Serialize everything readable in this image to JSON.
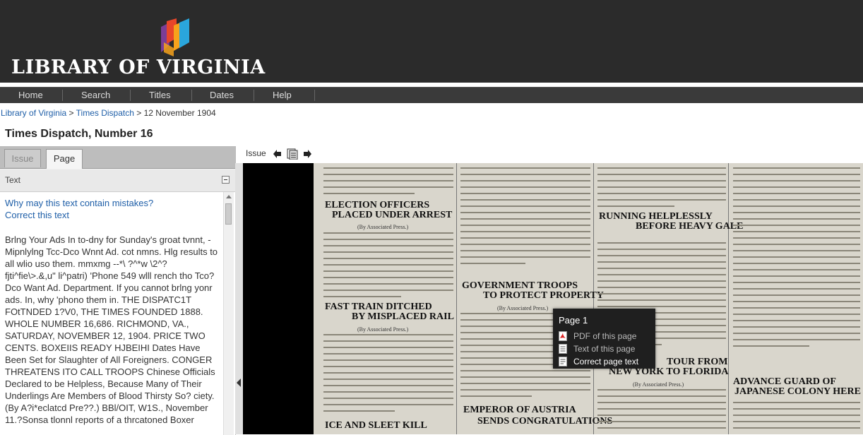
{
  "brand": {
    "logo_text": "LIBRARY OF VIRGINIA",
    "logo_colors": [
      "#e8462a",
      "#f7a21b",
      "#2aa6dc",
      "#7a3d96"
    ]
  },
  "nav": {
    "items": [
      {
        "label": "Home"
      },
      {
        "label": "Search"
      },
      {
        "label": "Titles"
      },
      {
        "label": "Dates"
      },
      {
        "label": "Help"
      }
    ]
  },
  "breadcrumb": {
    "items": [
      "Library of Virginia",
      "Times Dispatch"
    ],
    "separator": ">",
    "current": "12 November 1904"
  },
  "page_title": "Times Dispatch, Number 16",
  "left_panel": {
    "tabs": [
      {
        "label": "Issue",
        "active": false
      },
      {
        "label": "Page",
        "active": true
      }
    ],
    "section_label": "Text",
    "links": {
      "mistakes": "Why may this text contain mistakes?",
      "correct": "Correct this text"
    },
    "ocr_text": "Brlng Your Ads In to-dny for Sunday's groat tvnnt, -Mipnlylng Tcc-Dco Wnnt Ad. cot nmns. Hlg results to all wlio uso them. mmxmg --*\\ ?^*w \\2^? fjti^fie\\>.&,u\" li^patri) 'Phone 549 wlll rench tho Tco?Dco Want Ad. Department. If you cannot brlng yonr ads. In, why 'phono them in. THE DISPATC1T FOtTNDED 1?V0, THE TIMES FOUNDED 1888. WHOLE NUMBER 16,686. RICHMOND, VA., SATURDAY, NOVEMBER 12, 1904. PRICE TWO CENTS. BOXEIIS READY HJBEIHI Dates Have Been Set for Slaughter of All Foreigners. CONGER THREATENS ITO CALL TROOPS Chinese Officials Declared to be Helpless, Because Many of Their Underlings Are Members of Blood Thirsty So? ciety. (By A?i*eclatcd Pre??.) BBl/OIT, W1S., November 11.?Sonsa tlonnl reports of a thrcatoned Boxer"
  },
  "viewer": {
    "label": "Issue",
    "headlines": {
      "c1a": "ELECTION OFFICERS",
      "c1b": "PLACED UNDER ARREST",
      "c1c": "FAST TRAIN DITCHED",
      "c1d": "BY MISPLACED RAIL",
      "c1e": "ICE AND SLEET KILL",
      "c2a": "GOVERNMENT TROOPS",
      "c2b": "TO PROTECT PROPERTY",
      "c2c": "EMPEROR OF AUSTRIA",
      "c2d": "SENDS CONGRATULATIONS",
      "c3a": "RUNNING HELPLESSLY",
      "c3b": "BEFORE HEAVY GALE",
      "c3c": "TOUR FROM",
      "c3d": "NEW YORK TO FLORIDA",
      "c4a": "ADVANCE GUARD OF",
      "c4b": "JAPANESE COLONY HERE"
    },
    "bylines": {
      "assoc": "(By Associated Press.)"
    }
  },
  "popup": {
    "title": "Page 1",
    "items": [
      {
        "label": "PDF of this page",
        "icon": "pdf-icon",
        "link": false
      },
      {
        "label": "Text of this page",
        "icon": "document-icon",
        "link": false
      },
      {
        "label": "Correct page text",
        "icon": "edit-document-icon",
        "link": true
      }
    ]
  }
}
